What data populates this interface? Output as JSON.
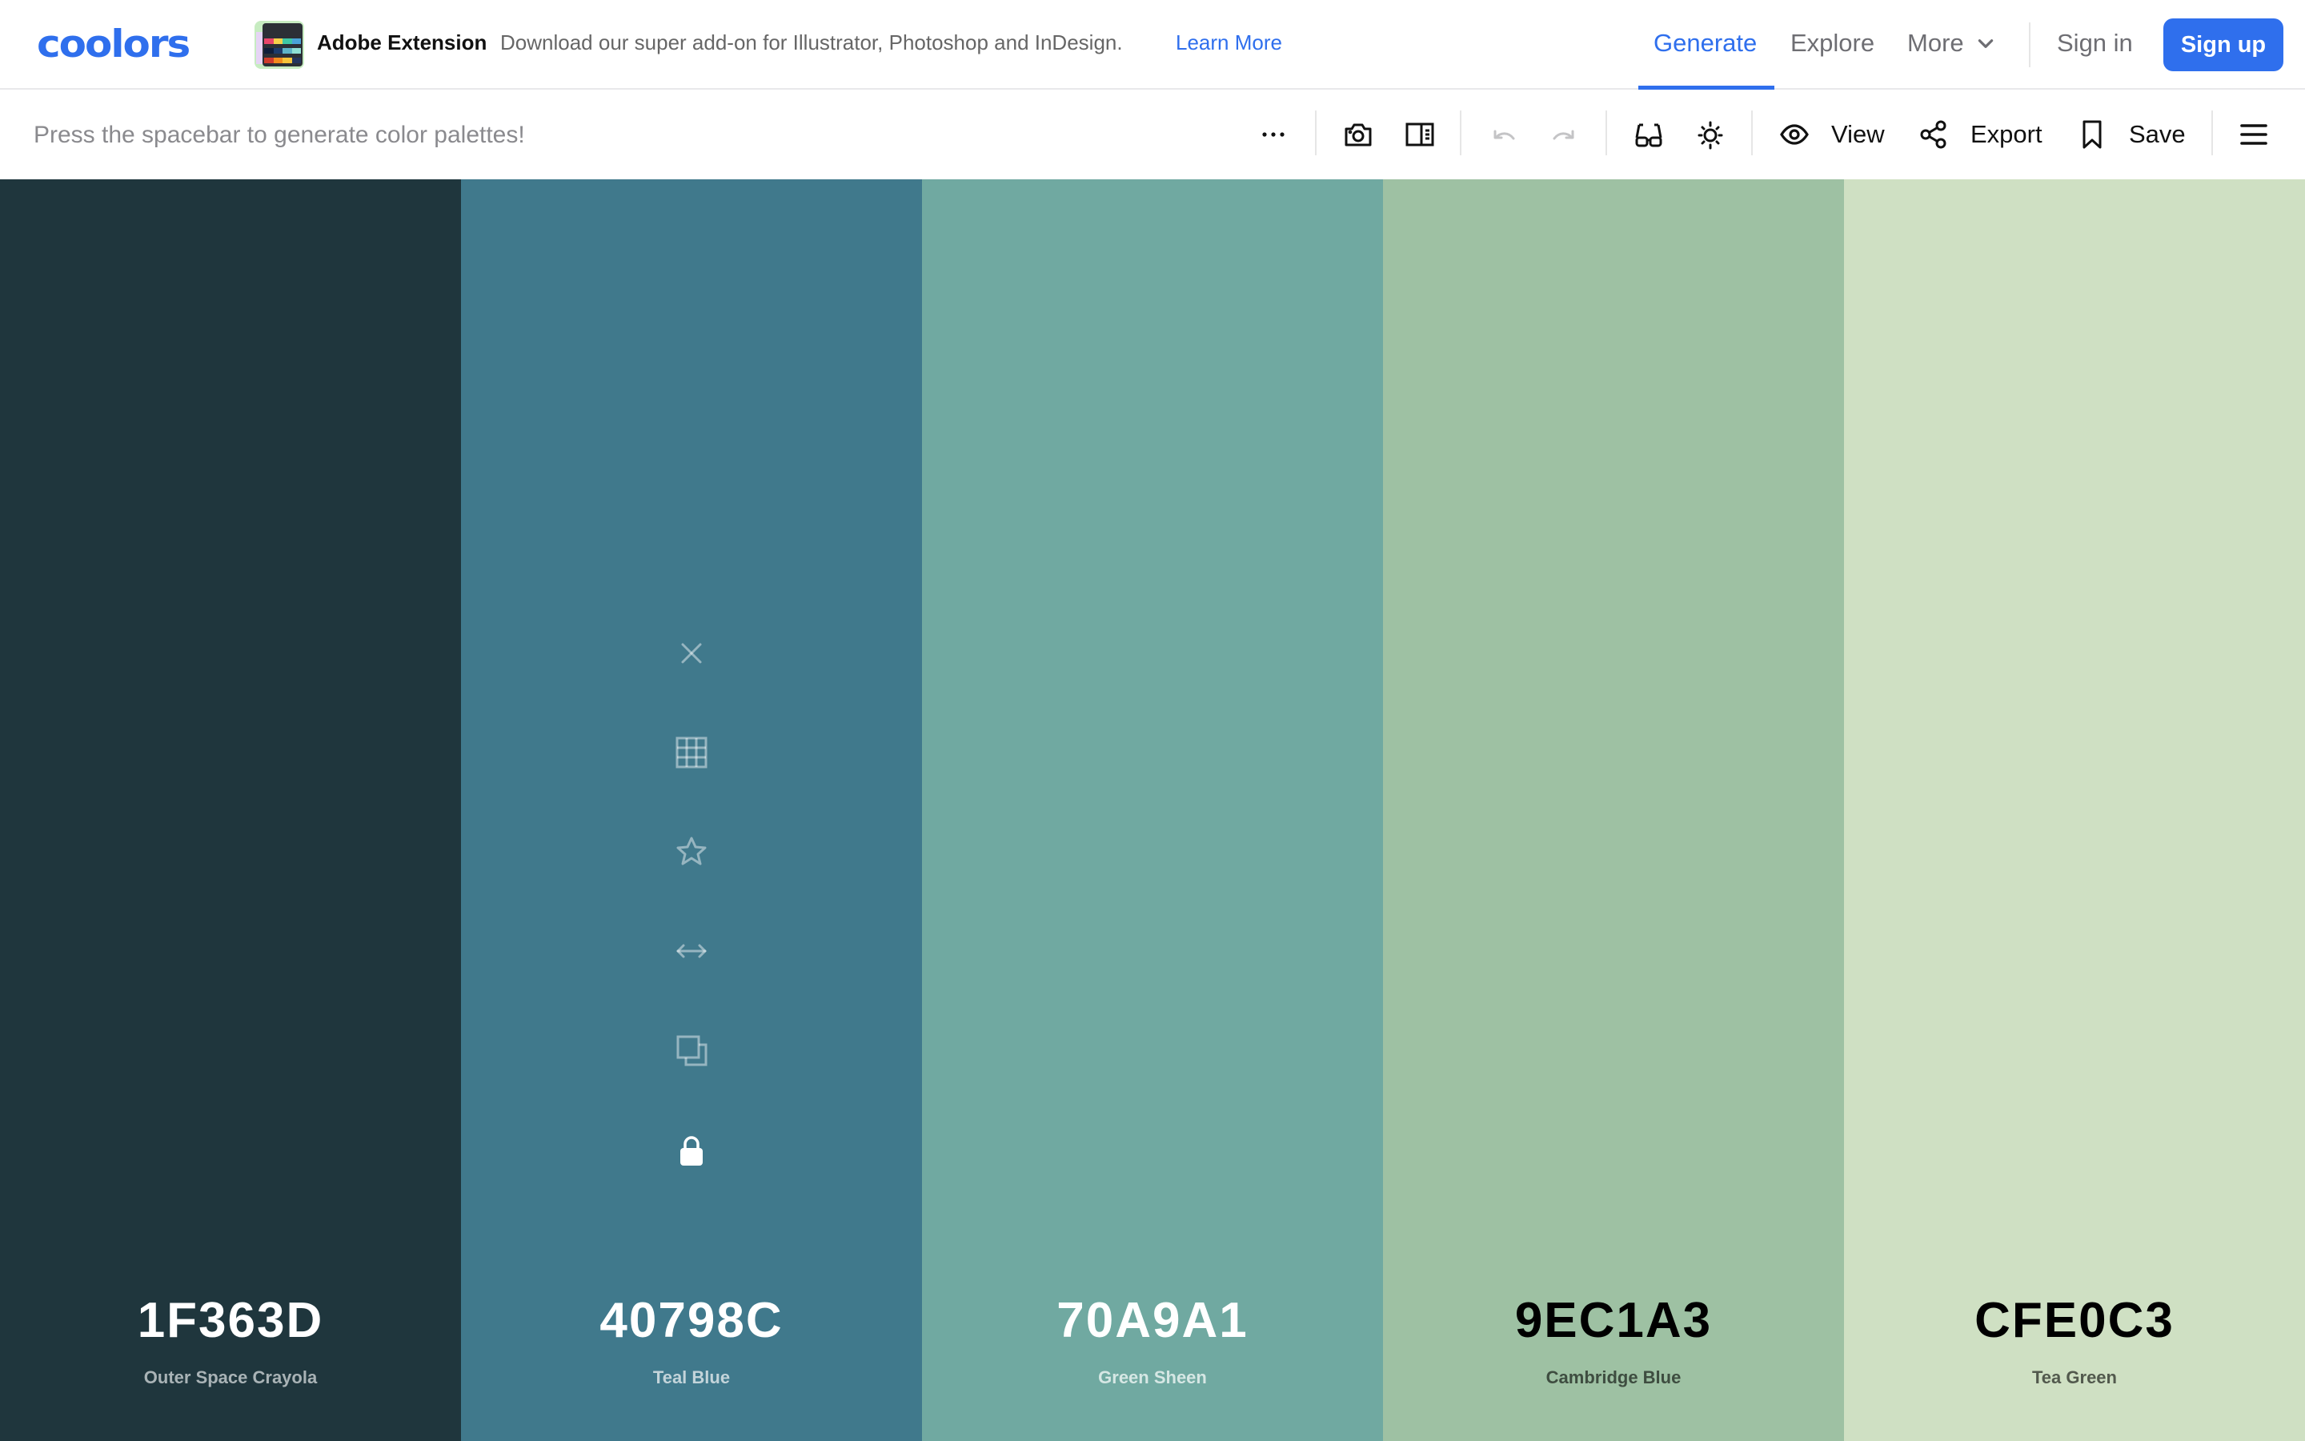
{
  "brand": {
    "logo_text": "coolors",
    "accent": "#2f6fed"
  },
  "promo": {
    "title": "Adobe Extension",
    "description": "Download our super add-on for Illustrator, Photoshop and InDesign.",
    "link": "Learn More"
  },
  "nav": {
    "items": [
      {
        "label": "Generate",
        "active": true
      },
      {
        "label": "Explore",
        "active": false
      },
      {
        "label": "More",
        "active": false,
        "has_dropdown": true
      }
    ],
    "sign_in": "Sign in",
    "sign_up": "Sign up"
  },
  "toolbar": {
    "hint": "Press the spacebar to generate color palettes!",
    "icons": [
      {
        "name": "more-options-icon",
        "enabled": true
      },
      {
        "name": "camera-icon",
        "enabled": true
      },
      {
        "name": "sidebar-panel-icon",
        "enabled": true
      },
      {
        "name": "undo-icon",
        "enabled": false
      },
      {
        "name": "redo-icon",
        "enabled": false
      },
      {
        "name": "glasses-icon",
        "enabled": true
      },
      {
        "name": "brightness-icon",
        "enabled": true
      }
    ],
    "buttons": [
      {
        "label": "View",
        "icon": "eye-icon"
      },
      {
        "label": "Export",
        "icon": "share-icon"
      },
      {
        "label": "Save",
        "icon": "bookmark-icon"
      }
    ],
    "menu_icon": "hamburger-menu-icon"
  },
  "palette": {
    "colors": [
      {
        "hex": "1F363D",
        "color": "#1F363D",
        "name": "Outer Space Crayola",
        "text_tone": "dark",
        "name_color": "#a9b3b6"
      },
      {
        "hex": "40798C",
        "color": "#40798C",
        "name": "Teal Blue",
        "text_tone": "dark",
        "name_color": "#c3d4da",
        "hovered": true,
        "locked": true
      },
      {
        "hex": "70A9A1",
        "color": "#70A9A1",
        "name": "Green Sheen",
        "text_tone": "dark",
        "name_color": "#d6e7e4"
      },
      {
        "hex": "9EC1A3",
        "color": "#9EC1A3",
        "name": "Cambridge Blue",
        "text_tone": "light",
        "name_color": "#3e4d40"
      },
      {
        "hex": "CFE0C3",
        "color": "#CFE0C3",
        "name": "Tea Green",
        "text_tone": "light",
        "name_color": "#52594d"
      }
    ],
    "hover_tools": [
      {
        "name": "remove-color-icon"
      },
      {
        "name": "view-shades-icon"
      },
      {
        "name": "favorite-star-icon"
      },
      {
        "name": "drag-move-icon"
      },
      {
        "name": "copy-icon"
      },
      {
        "name": "lock-icon"
      }
    ]
  }
}
